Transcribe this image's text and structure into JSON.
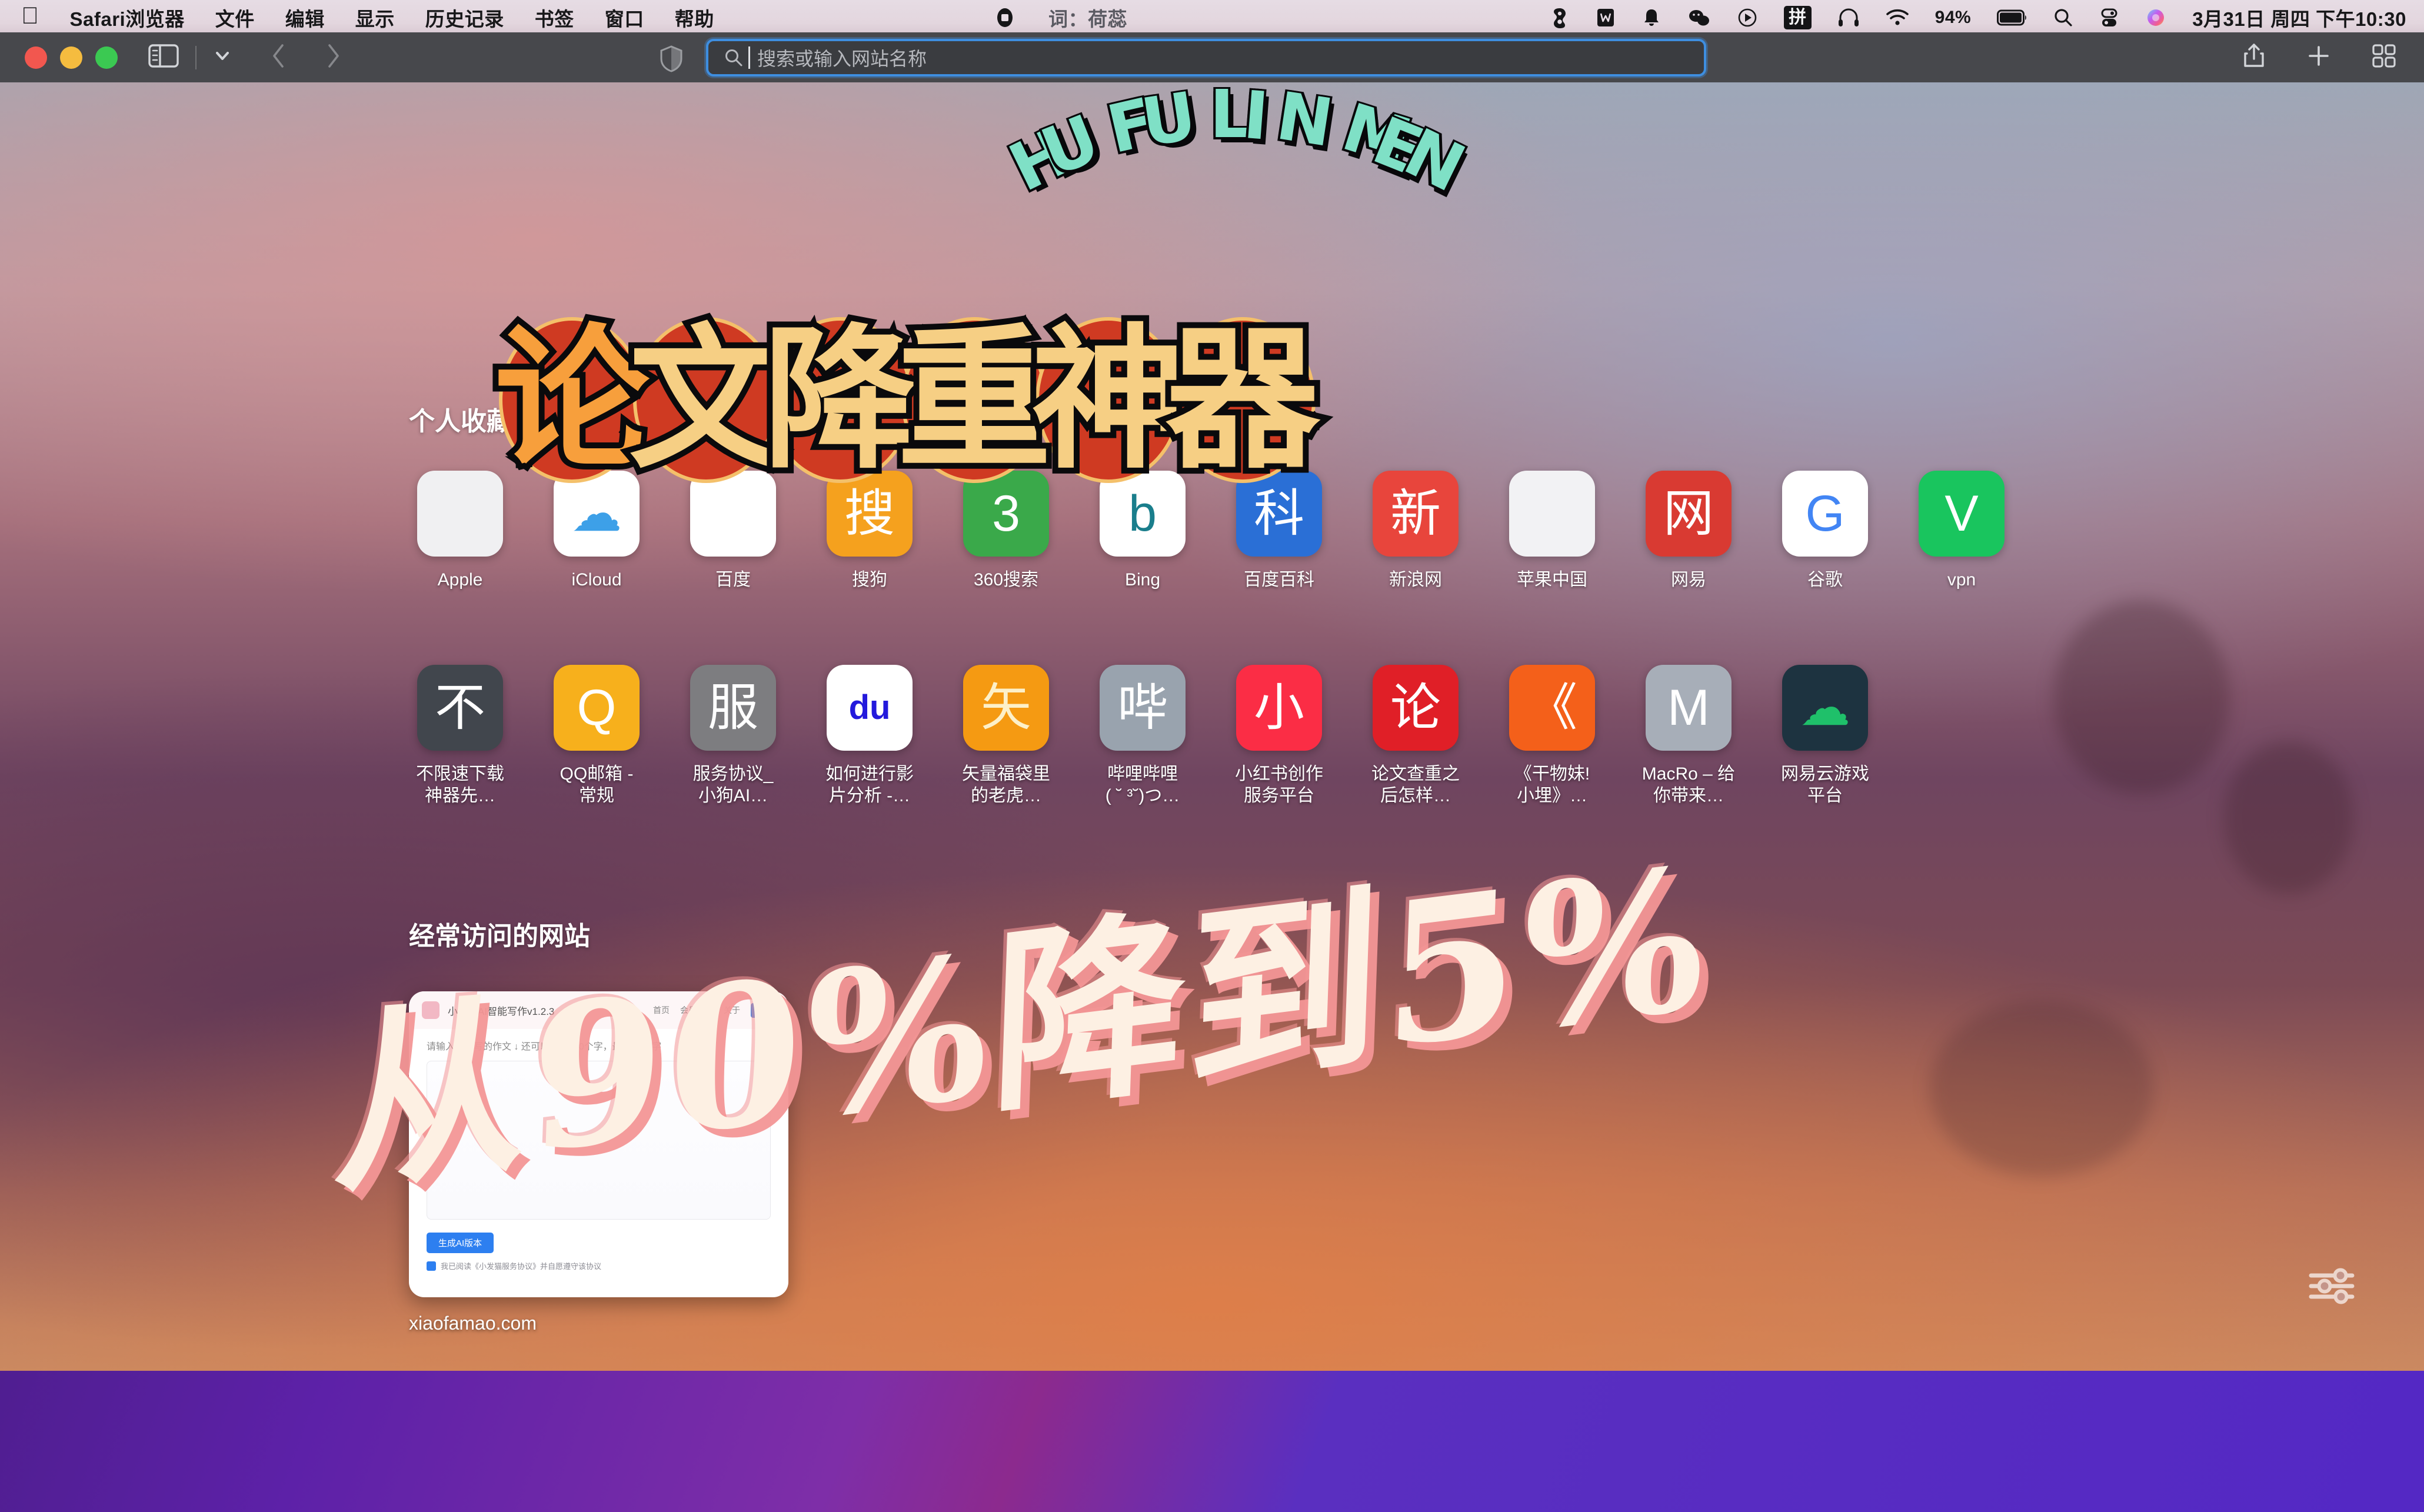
{
  "menubar": {
    "apple_icon": "apple-logo",
    "items": [
      "Safari浏览器",
      "文件",
      "编辑",
      "显示",
      "历史记录",
      "书签",
      "窗口",
      "帮助"
    ],
    "now_playing_icon": "stop-square-icon",
    "lyric": "词：荷蕊",
    "status_icons": [
      "sogou-icon",
      "wps-icon",
      "bell-icon",
      "wechat-icon",
      "play-circle-icon"
    ],
    "input_method": "拼",
    "headphone_icon": "headphones-icon",
    "wifi_icon": "wifi-icon",
    "battery_percent": "94%",
    "search_icon": "search-icon",
    "control_center_icon": "control-center-icon",
    "siri_icon": "siri-icon",
    "datetime": "3月31日 周四 下午10:30"
  },
  "toolbar": {
    "traffic_lights": [
      "close-button",
      "minimize-button",
      "zoom-button"
    ],
    "sidebar_icon": "sidebar-toggle-icon",
    "chevron_icon": "chevron-down-icon",
    "back_icon": "back-arrow-icon",
    "forward_icon": "forward-arrow-icon",
    "shield_icon": "privacy-shield-icon",
    "address_placeholder": "搜索或输入网站名称",
    "address_value": "",
    "share_icon": "share-icon",
    "new_tab_icon": "plus-icon",
    "tab_overview_icon": "tab-overview-icon",
    "accent_color": "#3e8ee0"
  },
  "startpage": {
    "favorites_title": "个人收藏",
    "favorites_row1": [
      {
        "label": "Apple",
        "glyph": "",
        "bg": "#f0f0f2",
        "fg": "#5b5b5f"
      },
      {
        "label": "iCloud",
        "glyph": "☁",
        "bg": "#ffffff",
        "fg": "#3da0e8"
      },
      {
        "label": "百度",
        "glyph": "",
        "bg": "#ffffff",
        "fg": "#2a32e8"
      },
      {
        "label": "搜狗",
        "glyph": "搜",
        "bg": "#f5a11e",
        "fg": "#ffffff"
      },
      {
        "label": "360搜索",
        "glyph": "3",
        "bg": "#3aa94a",
        "fg": "#ffffff"
      },
      {
        "label": "Bing",
        "glyph": "b",
        "bg": "#ffffff",
        "fg": "#1a7e8c"
      },
      {
        "label": "百度百科",
        "glyph": "科",
        "bg": "#2a6fd6",
        "fg": "#ffffff"
      },
      {
        "label": "新浪网",
        "glyph": "新",
        "bg": "#e8453c",
        "fg": "#ffffff"
      },
      {
        "label": "苹果中国",
        "glyph": "",
        "bg": "#f2f2f4",
        "fg": "#5b5b5f"
      },
      {
        "label": "网易",
        "glyph": "网",
        "bg": "#d93a32",
        "fg": "#ffffff"
      },
      {
        "label": "谷歌",
        "glyph": "G",
        "bg": "#ffffff",
        "fg": "#4285f4"
      },
      {
        "label": "vpn",
        "glyph": "V",
        "bg": "#19c55e",
        "fg": "#ffffff"
      }
    ],
    "favorites_row2": [
      {
        "label": "不限速下载\n神器先…",
        "glyph": "不",
        "bg": "#41464d",
        "fg": "#ffffff"
      },
      {
        "label": "QQ邮箱 -\n常规",
        "glyph": "Q",
        "bg": "#f7b01c",
        "fg": "#ffffff"
      },
      {
        "label": "服务协议_\n小狗AI…",
        "glyph": "服",
        "bg": "#7d7d80",
        "fg": "#ffffff"
      },
      {
        "label": "如何进行影\n片分析 -…",
        "glyph": "du",
        "bg": "#ffffff",
        "fg": "#2319dc"
      },
      {
        "label": "矢量福袋里\n的老虎…",
        "glyph": "矢",
        "bg": "#f59a12",
        "fg": "#fdf0c8"
      },
      {
        "label": "哔哩哔哩\n( ˘ ³˘)つ…",
        "glyph": "哔",
        "bg": "#99a3ae",
        "fg": "#ffffff"
      },
      {
        "label": "小红书创作\n服务平台",
        "glyph": "小",
        "bg": "#fb2d45",
        "fg": "#ffffff"
      },
      {
        "label": "论文查重之\n后怎样…",
        "glyph": "论",
        "bg": "#e01f27",
        "fg": "#ffffff"
      },
      {
        "label": "《干物妹!\n小埋》…",
        "glyph": "《",
        "bg": "#f4601a",
        "fg": "#ffffff"
      },
      {
        "label": "MacRo – 给\n你带来…",
        "glyph": "M",
        "bg": "#a7aeb8",
        "fg": "#ffffff"
      },
      {
        "label": "网易云游戏\n平台",
        "glyph": "☁",
        "bg": "#1d3340",
        "fg": "#1fc06a"
      }
    ],
    "frequent_title": "经常访问的网站",
    "frequent_site": {
      "label": "xiaofamao.com",
      "thumb_title": "小发猫AI智能写作v1.2.3",
      "thumb_menu": [
        "首页",
        "会员中心",
        "关于",
        "登录"
      ],
      "thumb_hint": "请输入要改写的作文 ↓ 还可以输入600个字，最多8000字",
      "thumb_cta": "生成AI版本",
      "thumb_agree": "我已阅读《小发猫服务协议》并自愿遵守该协议"
    },
    "settings_icon": "sliders-icon"
  },
  "overlay": {
    "arch_text": "HU FU LIN MEN",
    "arch_color": "#7fe0c6",
    "headline": "论文降重神器",
    "headline_colors": {
      "fill_orange": "#f79f3c",
      "fill_yellow": "#f6cf84",
      "circle": "#cf3a22",
      "ring": "#f4c06a"
    },
    "handwriting": "从90%降到5%",
    "handwriting_color": "#fdf0e3",
    "handwriting_shadow": "#f39696"
  }
}
